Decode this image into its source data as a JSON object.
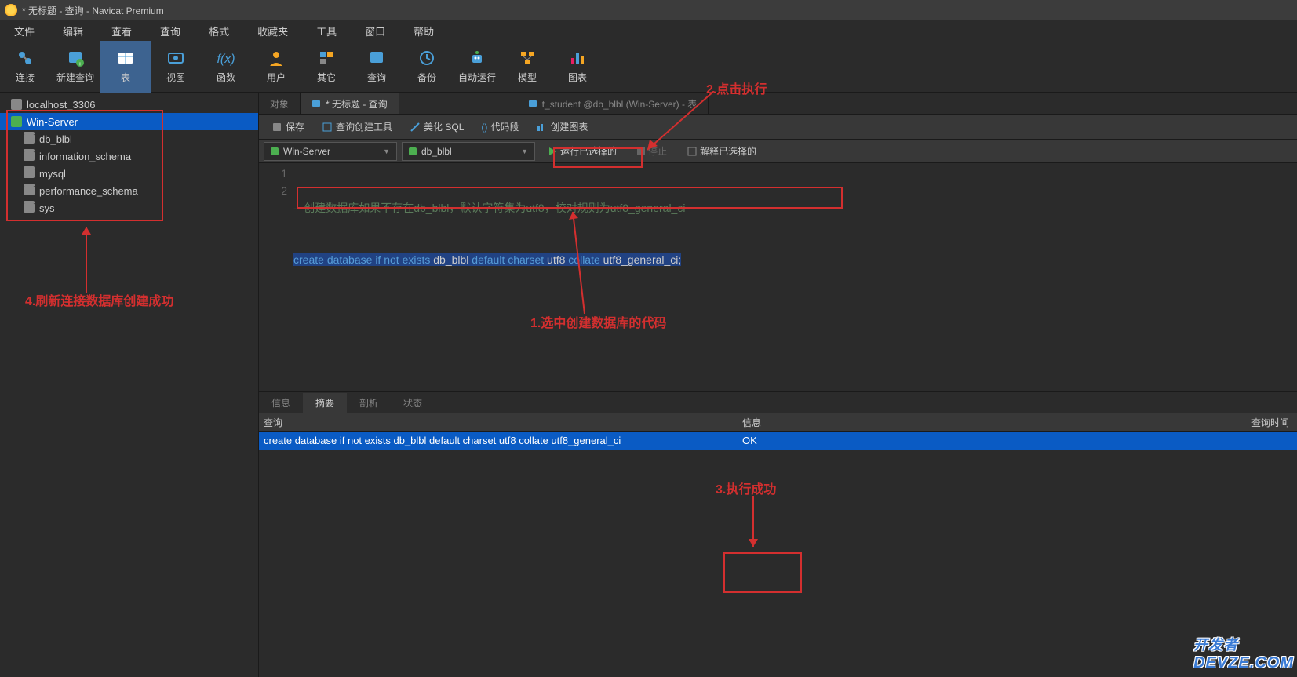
{
  "window": {
    "title": "* 无标题 - 查询 - Navicat Premium"
  },
  "menu": {
    "file": "文件",
    "edit": "编辑",
    "view": "查看",
    "query": "查询",
    "format": "格式",
    "favorites": "收藏夹",
    "tools": "工具",
    "window": "窗口",
    "help": "帮助"
  },
  "toolbar": {
    "connect": "连接",
    "newquery": "新建查询",
    "table": "表",
    "view": "视图",
    "function": "函数",
    "user": "用户",
    "other": "其它",
    "query": "查询",
    "backup": "备份",
    "autorun": "自动运行",
    "model": "模型",
    "chart": "图表"
  },
  "sidebar": {
    "conn_local": "localhost_3306",
    "conn_win": "Win-Server",
    "dbs": [
      "db_blbl",
      "information_schema",
      "mysql",
      "performance_schema",
      "sys"
    ]
  },
  "tabs": {
    "objects": "对象",
    "untitled": "* 无标题 - 查询",
    "student": "t_student @db_blbl (Win-Server) - 表"
  },
  "actions": {
    "save": "保存",
    "querybuilder": "查询创建工具",
    "beautify": "美化 SQL",
    "snippet": "代码段",
    "chart": "创建图表"
  },
  "runbar": {
    "conn": "Win-Server",
    "db": "db_blbl",
    "run": "运行已选择的",
    "stop": "停止",
    "explain": "解释已选择的"
  },
  "editor": {
    "line1_comment": "-- 创建数据库如果不存在db_blbl，默认字符集为utf8，校对规则为utf8_general_ci",
    "line2_sql": "create database if not exists db_blbl default charset utf8 collate utf8_general_ci;"
  },
  "bottom_tabs": {
    "info": "信息",
    "summary": "摘要",
    "profile": "剖析",
    "status": "状态"
  },
  "result": {
    "col_query": "查询",
    "col_info": "信息",
    "col_time": "查询时间",
    "row_query": "create database if not exists db_blbl default charset utf8 collate utf8_general_ci",
    "row_info": "OK"
  },
  "annotations": {
    "a1": "1.选中创建数据库的代码",
    "a2": "2.点击执行",
    "a3": "3.执行成功",
    "a4": "4.刷新连接数据库创建成功"
  },
  "watermark": {
    "cn": "开发者",
    "en": "DEVZE.COM"
  }
}
